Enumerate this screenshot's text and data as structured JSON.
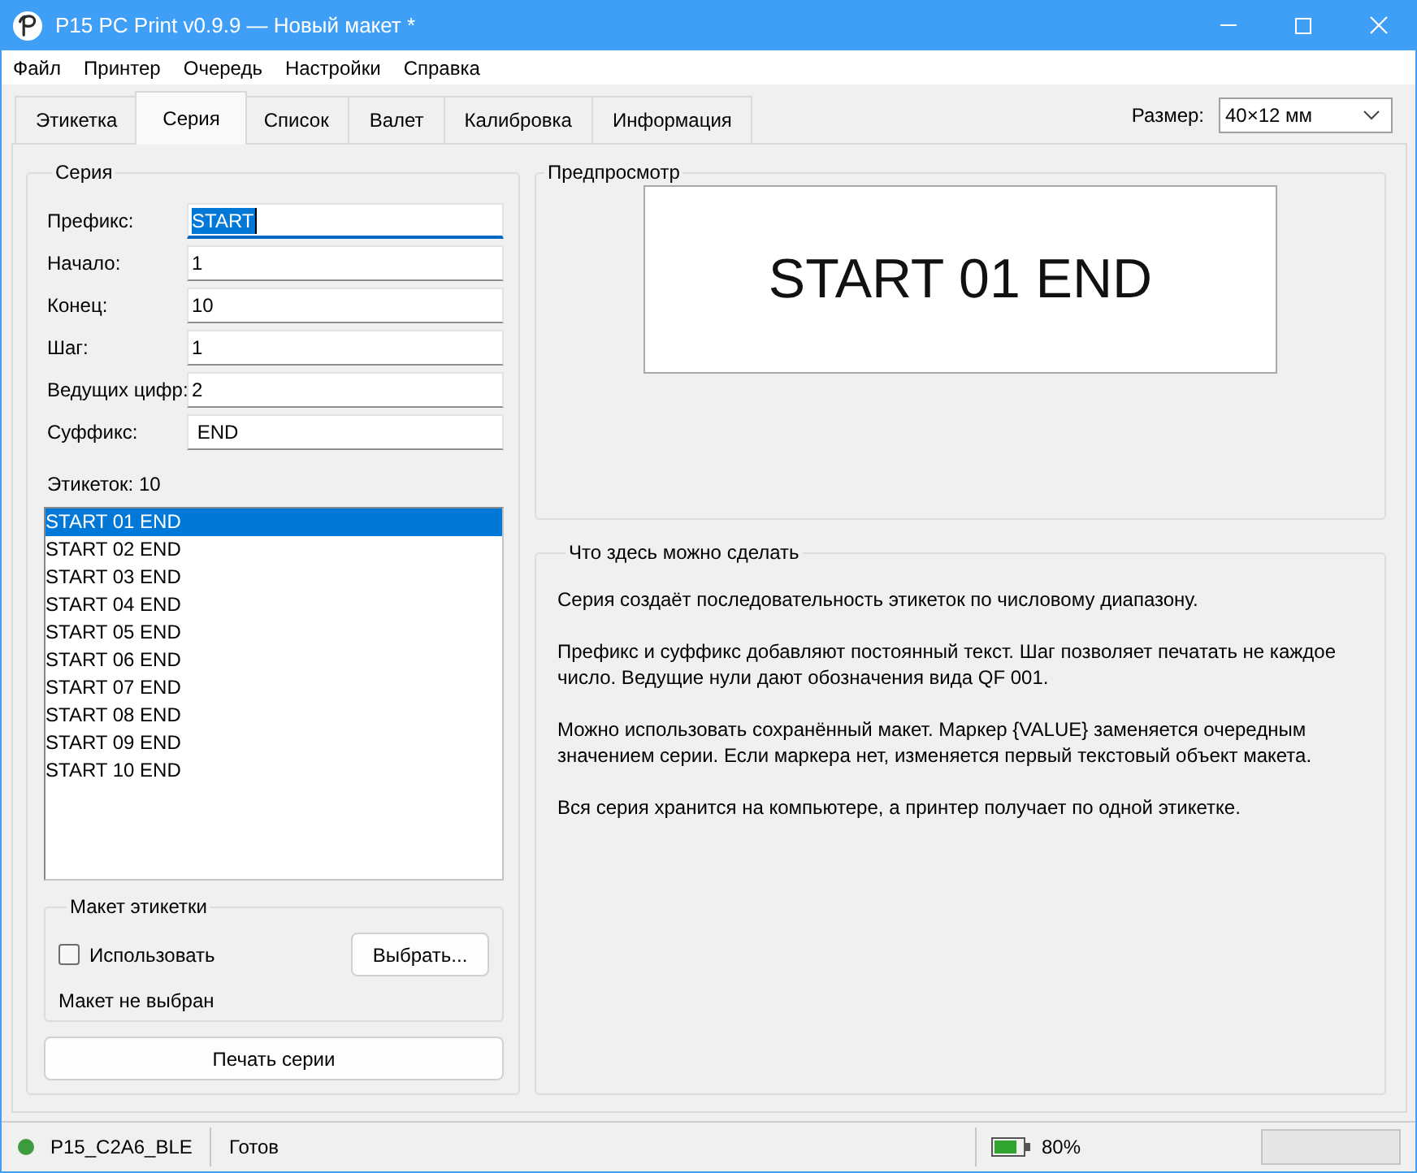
{
  "window": {
    "title": "P15 PC Print v0.9.9 — Новый макет *"
  },
  "menu": [
    "Файл",
    "Принтер",
    "Очередь",
    "Настройки",
    "Справка"
  ],
  "tabs": [
    {
      "label": "Этикетка",
      "selected": false
    },
    {
      "label": "Серия",
      "selected": true
    },
    {
      "label": "Список",
      "selected": false
    },
    {
      "label": "Валет",
      "selected": false
    },
    {
      "label": "Калибровка",
      "selected": false
    },
    {
      "label": "Информация",
      "selected": false
    }
  ],
  "size": {
    "label": "Размер:",
    "value": "40×12 мм"
  },
  "series": {
    "title": "Серия",
    "fields": [
      {
        "label": "Префикс:",
        "value": "START",
        "focused": true
      },
      {
        "label": "Начало:",
        "value": "1",
        "focused": false
      },
      {
        "label": "Конец:",
        "value": "10",
        "focused": false
      },
      {
        "label": "Шаг:",
        "value": "1",
        "focused": false
      },
      {
        "label": "Ведущих цифр:",
        "value": "2",
        "focused": false
      },
      {
        "label": "Суффикс:",
        "value": " END",
        "focused": false
      }
    ],
    "count": "Этикеток: 10",
    "items": [
      {
        "text": "START 01 END",
        "selected": true
      },
      {
        "text": "START 02 END",
        "selected": false
      },
      {
        "text": "START 03 END",
        "selected": false
      },
      {
        "text": "START 04 END",
        "selected": false
      },
      {
        "text": "START 05 END",
        "selected": false
      },
      {
        "text": "START 06 END",
        "selected": false
      },
      {
        "text": "START 07 END",
        "selected": false
      },
      {
        "text": "START 08 END",
        "selected": false
      },
      {
        "text": "START 09 END",
        "selected": false
      },
      {
        "text": "START 10 END",
        "selected": false
      }
    ],
    "layout": {
      "title": "Макет этикетки",
      "use": {
        "label": "Использовать",
        "checked": false
      },
      "choose_button": "Выбрать...",
      "status": "Макет не выбран"
    },
    "print_button": "Печать серии"
  },
  "preview": {
    "title": "Предпросмотр",
    "label_text": "START 01 END"
  },
  "help": {
    "title": "Что здесь можно сделать",
    "paragraphs": [
      "Серия создаёт последовательность этикеток по числовому диапазону.",
      "Префикс и суффикс добавляют постоянный текст. Шаг позволяет печатать не каждое число. Ведущие нули дают обозначения вида QF 001.",
      "Можно использовать сохранённый макет. Маркер {VALUE} заменяется очередным значением серии. Если маркера нет, изменяется первый текстовый объект макета.",
      "Вся серия хранится на компьютере, а принтер получает по одной этикетке."
    ]
  },
  "status_bar": {
    "printer": {
      "name": "P15_C2A6_BLE",
      "connected": true
    },
    "status": "Готов",
    "battery": "80%"
  }
}
